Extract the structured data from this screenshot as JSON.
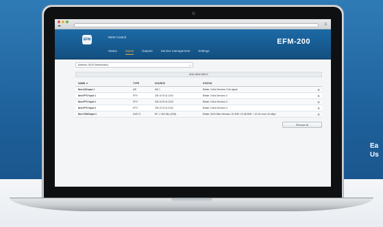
{
  "browser": {
    "url": "",
    "traffic_lights": [
      "#e05a4f",
      "#e8b33b",
      "#5fb543"
    ]
  },
  "app": {
    "name": "NEW Control",
    "product": "EFM-200",
    "logo_text": "EFM",
    "tabs": [
      {
        "label": "Status",
        "active": false
      },
      {
        "label": "Inputs",
        "active": true
      },
      {
        "label": "Outputs",
        "active": false
      },
      {
        "label": "Service management",
        "active": false
      },
      {
        "label": "Settings",
        "active": false
      }
    ]
  },
  "filter": {
    "value": "Address: All (5 Streams/sec)",
    "clear": "×"
  },
  "add_input": "ADD NEW INPUT",
  "table": {
    "headers": {
      "name": "NAME ▼",
      "type": "TYPE",
      "source": "SOURCE",
      "status": "STATUS"
    },
    "rows": [
      {
        "name": "New ASI Input 1",
        "type": "ASI",
        "source": "ASI 1",
        "status": "Bitrate: 0 kb/s       Services: 0     No signal"
      },
      {
        "name": "New IPTV Input 1",
        "type": "IPTV",
        "source": "239.10.75.41:1234",
        "status": "Bitrate: 0 kb/s       Services: 0"
      },
      {
        "name": "New IPTV Input 2",
        "type": "IPTV",
        "source": "239.10.75.41:1234",
        "status": "Bitrate: 0 kb/s       Services: 0"
      },
      {
        "name": "New IPTV Input 3",
        "type": "IPTV",
        "source": "239.10.75.41:1234",
        "status": "Bitrate: 0 kb/s       Services: 0"
      },
      {
        "name": "New T2/MI Input 1",
        "type": "DVB-T2",
        "source": "RF 1 / 602 Mhz (DVB)",
        "status": "Bitrate: 35.00 Mb/s   Services: 16   SNR: 0.5 dB   BER: < 1E-16   Level: 45 dBµV"
      }
    ]
  },
  "remove_all": "Remove all",
  "side_caption": {
    "line1": "Ea",
    "line2": "Us"
  }
}
